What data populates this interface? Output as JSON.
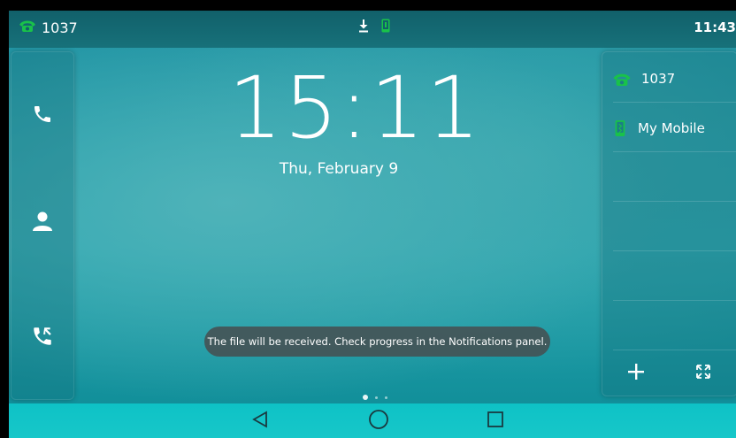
{
  "status_bar": {
    "line_number": "1037",
    "time": "11:43",
    "icons": [
      "phone-handset-icon",
      "download-icon",
      "mobile-phone-icon"
    ]
  },
  "home": {
    "clock": "15:11",
    "date": "Thu, February 9"
  },
  "left_panel": {
    "buttons": [
      "phone-icon",
      "contacts-icon",
      "call-history-icon"
    ]
  },
  "right_panel": {
    "accounts": [
      {
        "label": "1037",
        "icon": "phone-handset-icon"
      },
      {
        "label": "My Mobile",
        "icon": "mobile-phone-icon"
      }
    ],
    "bottom_buttons": [
      "add-icon",
      "fullscreen-icon"
    ]
  },
  "toast": {
    "message": "The file will be received. Check progress in the Notifications panel."
  },
  "page_indicator": {
    "pages": 3,
    "active": 0
  },
  "nav_bar": {
    "buttons": [
      "back-icon",
      "home-icon",
      "recents-icon"
    ]
  },
  "colors": {
    "accent_green": "#19c24a",
    "navbar": "#10c4c7",
    "wallpaper": "#2aa6b0"
  }
}
